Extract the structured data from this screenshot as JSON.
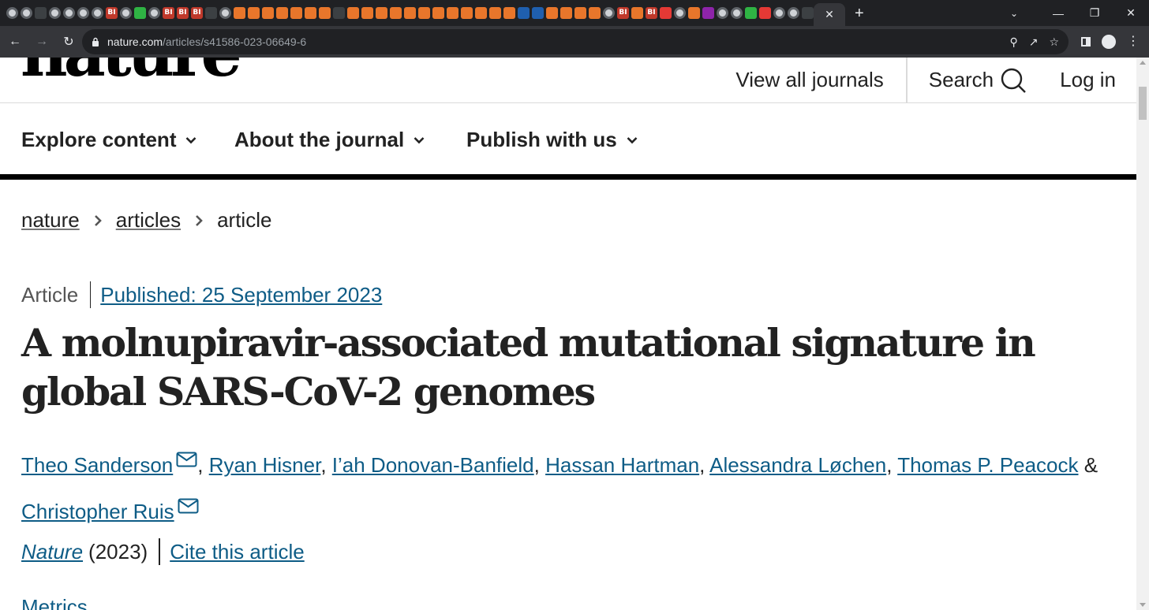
{
  "browser": {
    "url_host": "nature.com",
    "url_path": "/articles/s41586-023-06649-6",
    "tab_favicons": [
      "globe",
      "globe",
      "dark",
      "globe",
      "globe",
      "globe",
      "globe",
      "bi",
      "globe",
      "green",
      "globe",
      "bi",
      "bi",
      "bi",
      "dark",
      "globe",
      "orange",
      "orange",
      "orange",
      "orange",
      "orange",
      "orange",
      "orange",
      "dark",
      "orange",
      "orange",
      "orange",
      "orange",
      "orange",
      "orange",
      "orange",
      "orange",
      "orange",
      "orange",
      "orange",
      "orange",
      "blue",
      "blue",
      "orange",
      "orange",
      "orange",
      "orange",
      "globe",
      "bi",
      "orange",
      "bi",
      "red",
      "globe",
      "orange",
      "purple",
      "globe",
      "globe",
      "green",
      "red",
      "globe",
      "globe",
      "dark"
    ],
    "new_tab_label": "+",
    "tab_close_label": "✕"
  },
  "site": {
    "logo": "nature",
    "view_all_journals": "View all journals",
    "search": "Search",
    "login": "Log in"
  },
  "nav": {
    "items": [
      "Explore content",
      "About the journal",
      "Publish with us"
    ]
  },
  "breadcrumb": {
    "items": [
      "nature",
      "articles"
    ],
    "current": "article"
  },
  "article": {
    "type": "Article",
    "published": "Published: 25 September 2023",
    "title": "A molnupiravir-associated mutational signature in global SARS-CoV-2 genomes",
    "authors": [
      "Theo Sanderson",
      "Ryan Hisner",
      "I’ah Donovan-Banfield",
      "Hassan Hartman",
      "Alessandra Løchen",
      "Thomas P. Peacock",
      "Christopher Ruis"
    ],
    "author_separator": ", ",
    "author_conjunction": " & ",
    "journal": "Nature",
    "year": "(2023)",
    "cite": "Cite this article",
    "metrics": "Metrics"
  },
  "colors": {
    "link": "#0e5c86",
    "text": "#222222",
    "chrome_dark": "#202124",
    "chrome_toolbar": "#35363a"
  }
}
